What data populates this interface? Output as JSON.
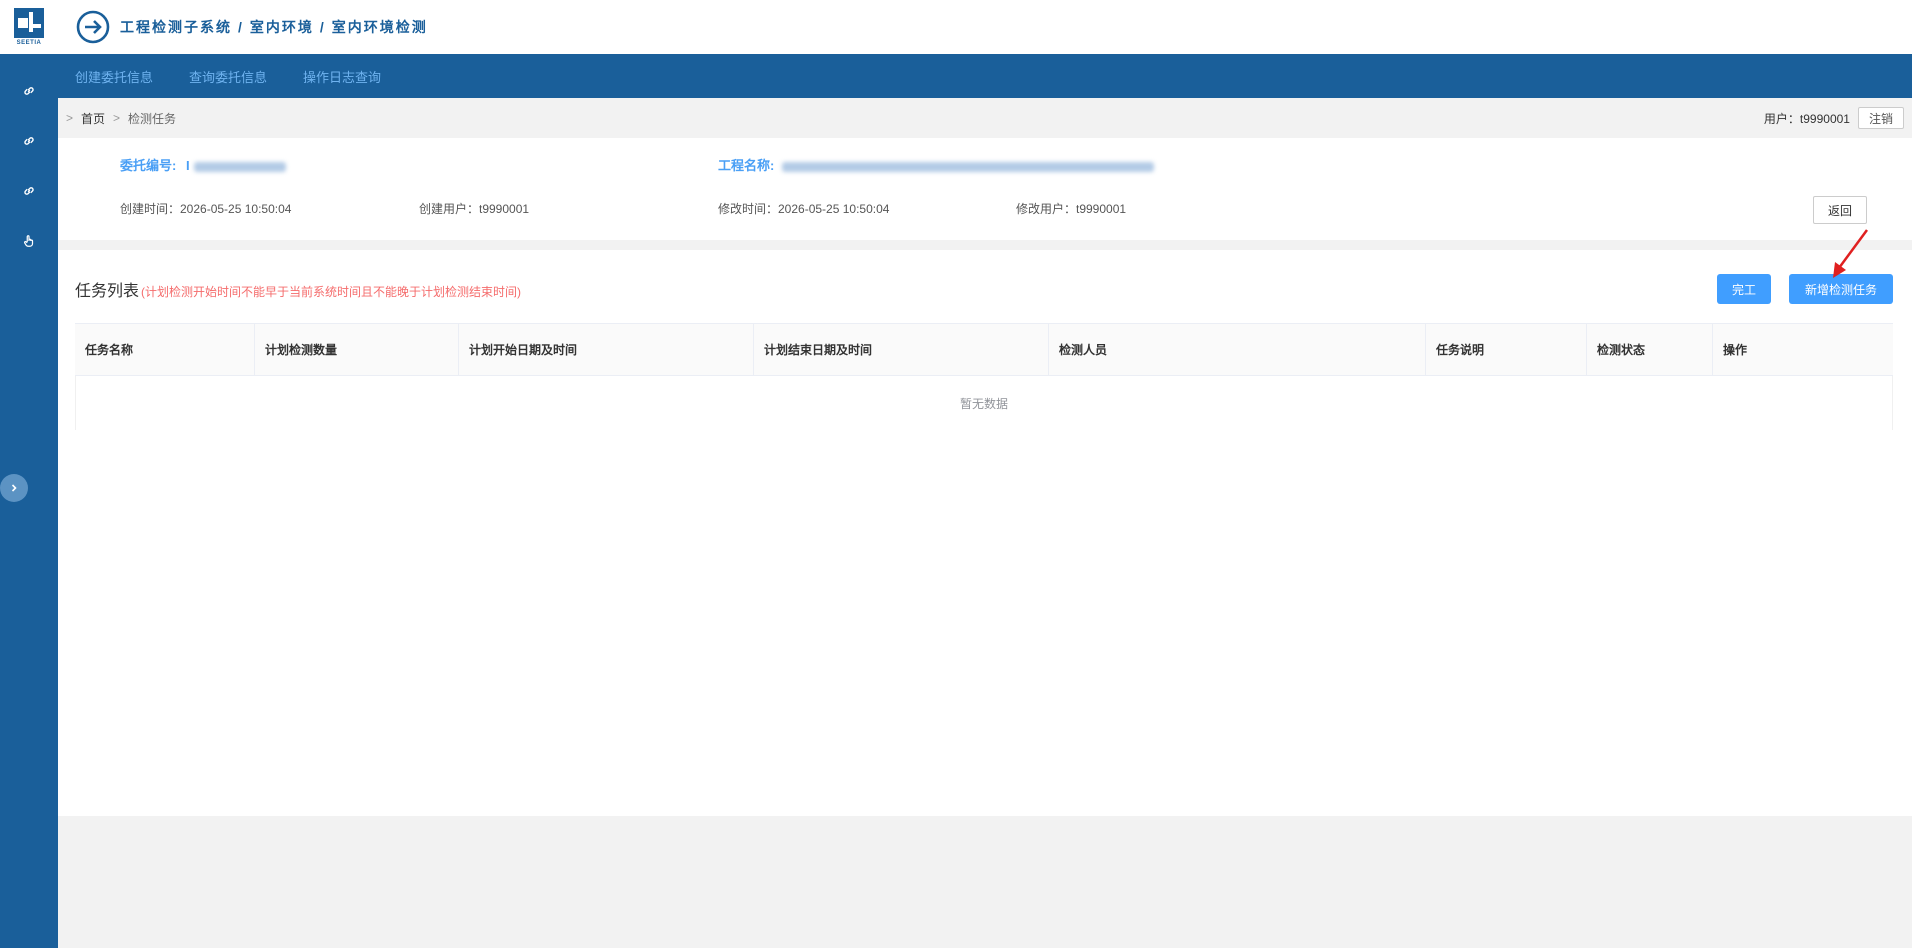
{
  "logo": {
    "text": "SEETIA"
  },
  "header": {
    "breadcrumb": [
      "工程检测子系统",
      "室内环境",
      "室内环境检测"
    ],
    "separator": "/"
  },
  "menu": {
    "items": [
      "创建委托信息",
      "查询委托信息",
      "操作日志查询"
    ]
  },
  "sidebar": {
    "icons": [
      "link-icon",
      "link-icon",
      "link-icon",
      "hand-pointer-icon"
    ],
    "collapse_icon": "chevron-right-icon"
  },
  "breadcrumb": {
    "prefix": ">",
    "home": "首页",
    "current": "检测任务"
  },
  "user": {
    "label": "用户：t9990001",
    "logout_label": "注销"
  },
  "info": {
    "entrust_no_label": "委托编号:",
    "entrust_no_value": "I",
    "project_name_label": "工程名称:",
    "created_time": "创建时间：2026-05-25 10:50:04",
    "created_user": "创建用户：t9990001",
    "modified_time": "修改时间：2026-05-25 10:50:04",
    "modified_user": "修改用户：t9990001",
    "back_label": "返回"
  },
  "tasks": {
    "title": "任务列表",
    "hint": "(计划检测开始时间不能早于当前系统时间且不能晚于计划检测结束时间)",
    "complete_label": "完工",
    "add_label": "新增检测任务",
    "columns": [
      "任务名称",
      "计划检测数量",
      "计划开始日期及时间",
      "计划结束日期及时间",
      "检测人员",
      "任务说明",
      "检测状态",
      "操作"
    ],
    "empty_text": "暂无数据"
  },
  "colors": {
    "primary": "#1a5f9a",
    "accent": "#409eff",
    "hint_red": "#f56c6c",
    "annotation_arrow": "#e02020"
  }
}
